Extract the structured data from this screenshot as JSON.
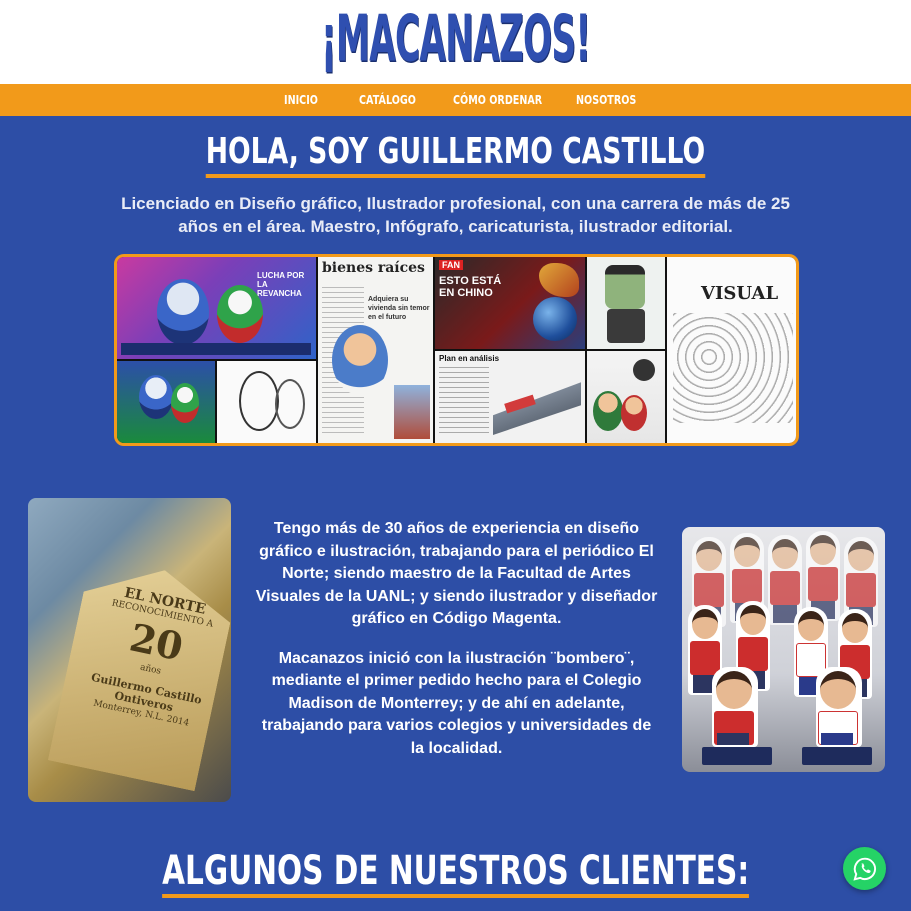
{
  "brand": {
    "logo_text": "¡MACANAZOS!"
  },
  "nav": {
    "items": [
      {
        "label": "INICIO"
      },
      {
        "label": "CATÁLOGO"
      },
      {
        "label": "CÓMO ORDENAR"
      },
      {
        "label": "NOSOTROS"
      }
    ]
  },
  "hero": {
    "title": "HOLA, SOY GUILLERMO CASTILLO",
    "intro": "Licenciado en Diseño gráfico, Ilustrador profesional, con una carrera de más de 25 años en el área. Maestro, Infógrafo, caricaturista, ilustrador editorial."
  },
  "collage": {
    "tiles": [
      {
        "heading": "LUCHA POR LA REVANCHA"
      },
      {
        "heading": "bienes raíces"
      },
      {
        "heading": "Adquiera su vivienda sin temor en el futuro"
      },
      {
        "heading": "FAN"
      },
      {
        "heading": "ESTO ESTÁ EN CHINO"
      },
      {
        "heading": "VISUAL"
      },
      {
        "heading": "Plan en análisis"
      }
    ]
  },
  "award": {
    "brand": "EL NORTE",
    "subtitle": "RECONOCIMIENTO A",
    "number": "20",
    "unit": "años",
    "name": "Guillermo Castillo Ontiveros",
    "place": "Monterrey, N.L. 2014"
  },
  "bio": {
    "paragraph1": "Tengo más de 30 años de experiencia en diseño gráfico e ilustración, trabajando para el periódico El Norte; siendo maestro de la Facultad de Artes Visuales de la UANL; y siendo ilustrador y diseñador gráfico en Código Magenta.",
    "paragraph2": "Macanazos inició con la ilustración ¨bombero¨, mediante el primer pedido hecho para el Colegio Madison de Monterrey; y de ahí en adelante, trabajando para varios colegios y universidades de la localidad."
  },
  "clients": {
    "title": "ALGUNOS DE NUESTROS CLIENTES:"
  },
  "widgets": {
    "whatsapp_icon": "whatsapp-icon"
  },
  "colors": {
    "primary_blue": "#2d4ea6",
    "accent_orange": "#f29a1a",
    "whatsapp_green": "#25d366"
  }
}
